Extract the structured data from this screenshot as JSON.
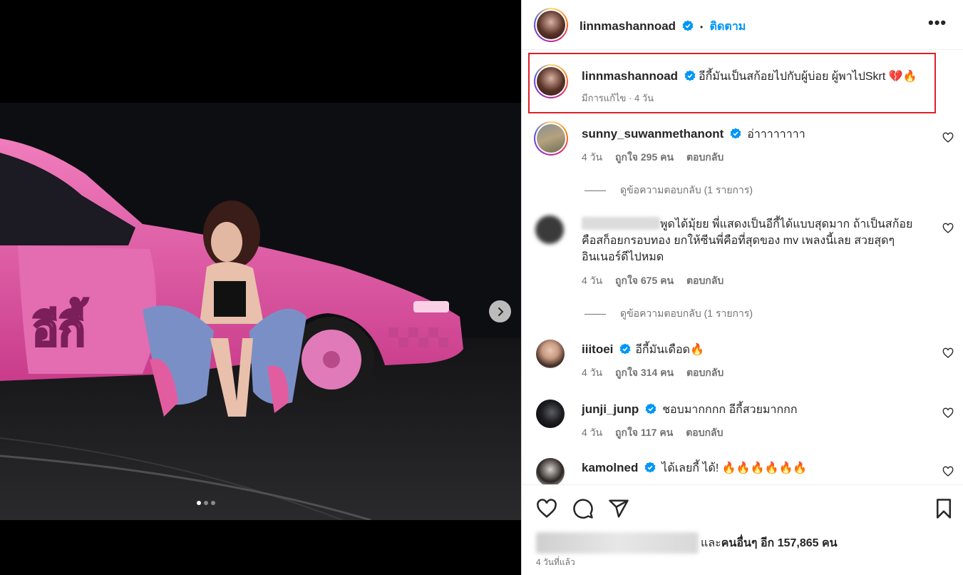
{
  "post": {
    "author": "linnmashannoad",
    "follow_label": "ติดตาม",
    "separator": "•",
    "more_label": "•••",
    "caption": "อีกี้มันเป็นสก้อยไปกับผู้บ่อย ผู้พาไปSkrt 💔🔥",
    "caption_meta": "มีการแก้ไข · 4 วัน",
    "carousel": {
      "slides": 3,
      "active": 0
    }
  },
  "comments": [
    {
      "username": "sunny_suwanmethanont",
      "verified": true,
      "text": "อ่าาาาาาาา",
      "time": "4 วัน",
      "likes": "ถูกใจ 295 คน",
      "reply": "ตอบกลับ",
      "view_replies": "ดูข้อความตอบกลับ (1 รายการ)"
    },
    {
      "username": "",
      "verified": false,
      "text_line1": "พูดได้มุ้ยย พี่แสดงเป็นอีกี้ได้แบบสุดมาก ถ้าเป็นสก้อย",
      "text_line2": "คือสก็อยกรอบทอง ยกให้ซีนพี่คือที่สุดของ mv เพลงนี้เลย สวยสุดๆ",
      "text_line3": "อินเนอร์ดีไปหมด",
      "time": "4 วัน",
      "likes": "ถูกใจ 675 คน",
      "reply": "ตอบกลับ",
      "view_replies": "ดูข้อความตอบกลับ (1 รายการ)"
    },
    {
      "username": "iiitoei",
      "verified": true,
      "text": "อีกี้มันเดือด🔥",
      "time": "4 วัน",
      "likes": "ถูกใจ 314 คน",
      "reply": "ตอบกลับ"
    },
    {
      "username": "junji_junp",
      "verified": true,
      "text": "ชอบมากกกก อีกี้สวยมากกก",
      "time": "4 วัน",
      "likes": "ถูกใจ 117 คน",
      "reply": "ตอบกลับ"
    },
    {
      "username": "kamolned",
      "verified": true,
      "text": "ได้เลยกี้ ได้! 🔥🔥🔥🔥🔥🔥"
    }
  ],
  "footer": {
    "likes_prefix": "และ",
    "likes_others": "คนอื่นๆ อีก 157,865 คน",
    "time_ago": "4 วันที่แล้ว"
  },
  "colors": {
    "accent": "#0095f6",
    "verified": "#0095f6",
    "highlight_box": "#e0202a",
    "car_pink": "#e85aa8"
  },
  "icons": [
    "heart-icon",
    "comment-icon",
    "share-icon",
    "bookmark-icon",
    "more-icon",
    "verified-icon",
    "chevron-right-icon"
  ]
}
